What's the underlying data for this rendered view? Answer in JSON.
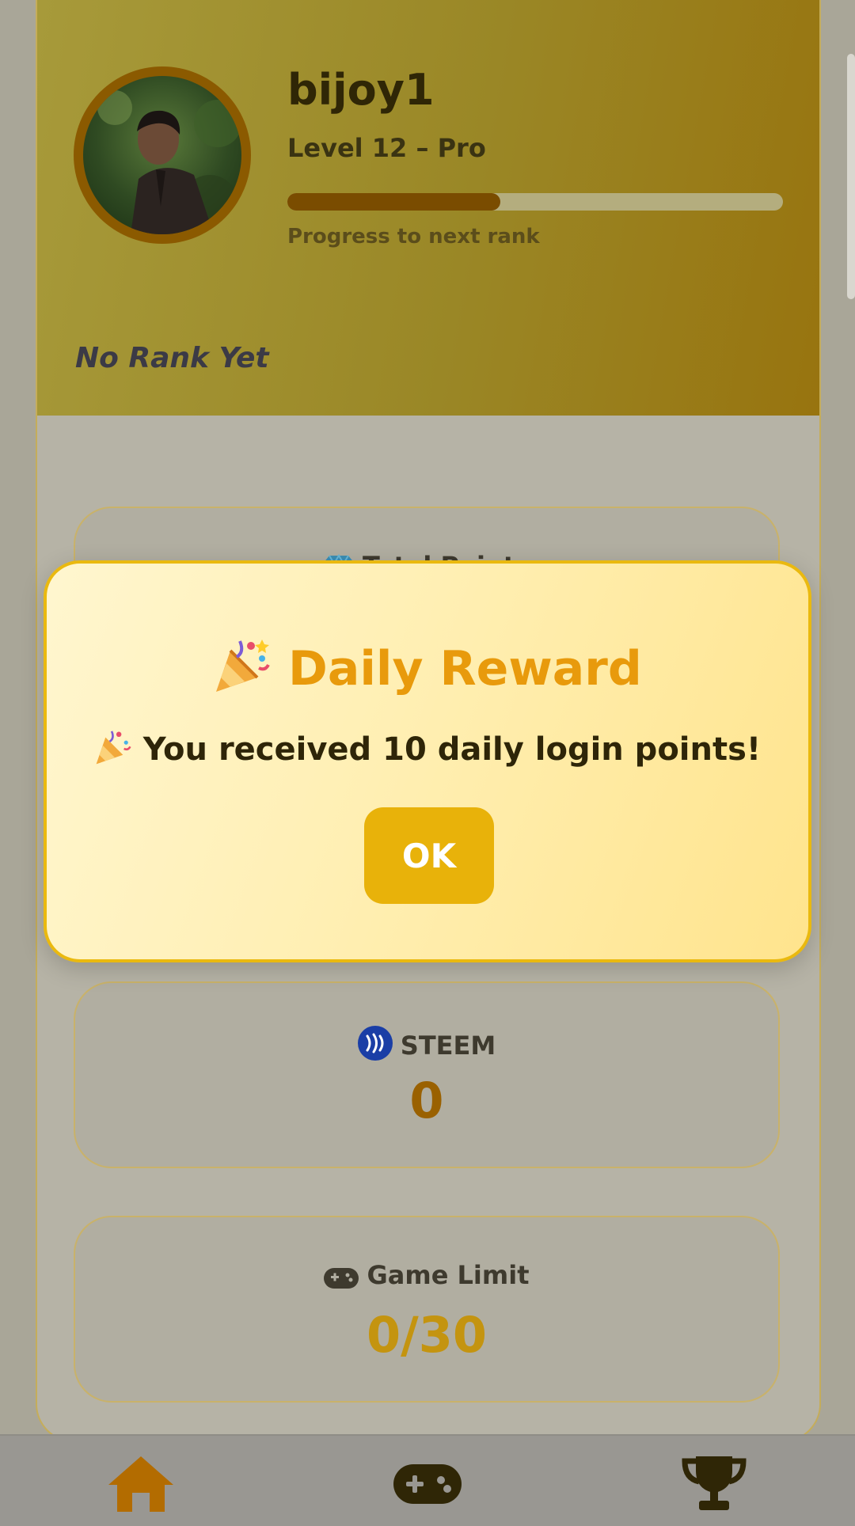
{
  "profile": {
    "username": "bijoy1",
    "level": "Level 12 – Pro",
    "progress": 0.43,
    "progress_caption": "Progress to next rank",
    "rank": "No Rank Yet"
  },
  "stats": [
    {
      "icon": "gem-icon",
      "label": "Total Points",
      "value": ""
    },
    {
      "icon": "steem-icon",
      "label": "STEEM",
      "value": "0",
      "color": "#9a6100"
    },
    {
      "icon": "gamepad-icon",
      "label": "Game Limit",
      "value": "0/30",
      "color": "#c49410"
    }
  ],
  "modal": {
    "title": "Daily Reward",
    "title_emoji": "party-popper-icon",
    "message": "You received 10 daily login points!",
    "ok_label": "OK"
  },
  "nav": [
    {
      "icon": "home-icon",
      "active": true
    },
    {
      "icon": "gamepad-icon",
      "active": false
    },
    {
      "icon": "trophy-icon",
      "active": false
    }
  ],
  "colors": {
    "accent": "#e8b20a",
    "title": "#e89a0c",
    "header_dark": "#8b5a00"
  }
}
